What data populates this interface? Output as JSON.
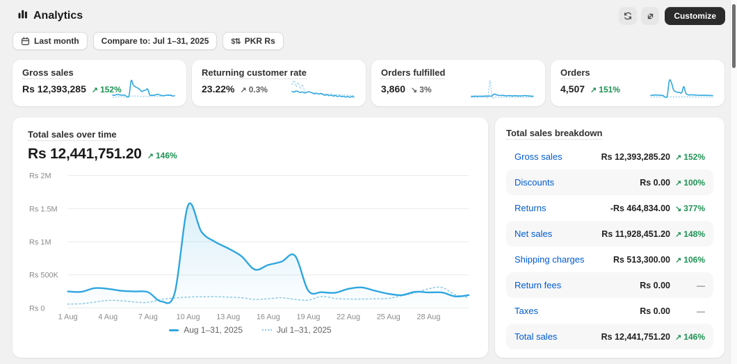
{
  "header": {
    "title": "Analytics",
    "customize_label": "Customize"
  },
  "filters": {
    "date_range": "Last month",
    "compare": "Compare to: Jul 1–31, 2025",
    "currency": "PKR Rs",
    "currency_glyph": "$⇅"
  },
  "colors": {
    "page_bg": "#f1f1f1",
    "accent_blue": "#2ea6df",
    "compare_blue": "#8fcae8",
    "link_blue": "#005bd3",
    "positive_green": "#1f9254",
    "neutral_gray": "#616161"
  },
  "cards": [
    {
      "title": "Gross sales",
      "value": "Rs 12,393,285",
      "arrow": "↗",
      "delta": "152%",
      "tone": "positive",
      "spark": {
        "main": [
          250,
          245,
          300,
          290,
          260,
          250,
          240,
          100,
          230,
          1550,
          1150,
          1000,
          900,
          780,
          580,
          650,
          700,
          790,
          260,
          240,
          230,
          290,
          310,
          260,
          215,
          195,
          245,
          235,
          235,
          175,
          195
        ],
        "compare": [
          60,
          65,
          90,
          115,
          110,
          90,
          85,
          130,
          150,
          165,
          170,
          170,
          165,
          155,
          130,
          140,
          155,
          130,
          120,
          175,
          145,
          135,
          135,
          140,
          145,
          185,
          230,
          290,
          310,
          200,
          160
        ]
      }
    },
    {
      "title": "Returning customer rate",
      "value": "23.22%",
      "arrow": "↗",
      "delta": "0.3%",
      "tone": "neutral",
      "spark": {
        "main": [
          23.5,
          23.2,
          23.8,
          23.4,
          23.0,
          23.3,
          22.8,
          23.0,
          23.4,
          23.1,
          22.7,
          22.3,
          22.6,
          22.2,
          22.5,
          22.0,
          21.6,
          21.9,
          21.4,
          21.7,
          21.2,
          21.5,
          21.0,
          21.3,
          20.9,
          21.1,
          20.7,
          21.0,
          20.6,
          20.9,
          20.7
        ],
        "compare": [
          27,
          29,
          26,
          28,
          25,
          27,
          24,
          23,
          23.5,
          23,
          22.8,
          23,
          22.5,
          22.3,
          22.6,
          22.4,
          22.2,
          22.4,
          22.1,
          22.3,
          22,
          21.8,
          22,
          21.9,
          21.7,
          21.8,
          21.6,
          21.7,
          21.5,
          21.6,
          21.4
        ]
      }
    },
    {
      "title": "Orders fulfilled",
      "value": "3,860",
      "arrow": "↘",
      "delta": "3%",
      "tone": "neutral",
      "spark": {
        "main": [
          118,
          116,
          120,
          117,
          121,
          118,
          120,
          123,
          119,
          122,
          125,
          160,
          148,
          138,
          132,
          136,
          130,
          127,
          131,
          128,
          125,
          130,
          127,
          124,
          126,
          129,
          132,
          127,
          124,
          121,
          119
        ],
        "compare": [
          100,
          99,
          101,
          100,
          102,
          100,
          101,
          103,
          102,
          420,
          101,
          100,
          102,
          101,
          100,
          102,
          101,
          103,
          100,
          102,
          101,
          100,
          102,
          101,
          103,
          102,
          100,
          101,
          102,
          100,
          101
        ]
      }
    },
    {
      "title": "Orders",
      "value": "4,507",
      "arrow": "↗",
      "delta": "151%",
      "tone": "positive",
      "spark": {
        "main": [
          140,
          138,
          146,
          144,
          140,
          138,
          134,
          100,
          130,
          430,
          390,
          250,
          210,
          200,
          195,
          190,
          310,
          180,
          150,
          146,
          148,
          145,
          142,
          140,
          138,
          140,
          139,
          138,
          137,
          136,
          135
        ],
        "compare": [
          105,
          103,
          106,
          104,
          105,
          103,
          104,
          106,
          105,
          107,
          106,
          105,
          107,
          106,
          104,
          106,
          105,
          107,
          105,
          106,
          104,
          105,
          106,
          104,
          106,
          105,
          107,
          106,
          105,
          104,
          105
        ]
      }
    }
  ],
  "chart_card": {
    "title": "Total sales over time",
    "value": "Rs 12,441,751.20",
    "arrow": "↗",
    "delta": "146%",
    "tone": "positive"
  },
  "chart_data": {
    "type": "line",
    "title": "Total sales over time",
    "unit": "PKR (thousands)",
    "ylim": [
      0,
      2000
    ],
    "grid": "horizontal",
    "y_ticks": [
      {
        "value": 2000,
        "label": "Rs 2M"
      },
      {
        "value": 1500,
        "label": "Rs 1.5M"
      },
      {
        "value": 1000,
        "label": "Rs 1M"
      },
      {
        "value": 500,
        "label": "Rs 500K"
      },
      {
        "value": 0,
        "label": "Rs 0"
      }
    ],
    "x_tick_days": [
      1,
      4,
      7,
      10,
      13,
      16,
      19,
      22,
      25,
      28
    ],
    "x_tick_labels": [
      "1 Aug",
      "4 Aug",
      "7 Aug",
      "10 Aug",
      "13 Aug",
      "16 Aug",
      "19 Aug",
      "22 Aug",
      "25 Aug",
      "28 Aug"
    ],
    "series": [
      {
        "name": "Aug 1–31, 2025",
        "style": "solid",
        "values": [
          250,
          245,
          300,
          290,
          260,
          250,
          240,
          100,
          230,
          1550,
          1150,
          1000,
          900,
          780,
          580,
          650,
          700,
          790,
          260,
          240,
          230,
          290,
          310,
          260,
          215,
          195,
          245,
          235,
          235,
          175,
          195
        ]
      },
      {
        "name": "Jul 1–31, 2025",
        "style": "dotted",
        "values": [
          60,
          65,
          90,
          115,
          110,
          90,
          85,
          130,
          150,
          165,
          170,
          170,
          165,
          155,
          130,
          140,
          155,
          130,
          120,
          175,
          145,
          135,
          135,
          140,
          145,
          185,
          230,
          290,
          310,
          200,
          160
        ]
      }
    ],
    "legend_position": "bottom-center"
  },
  "legend": [
    {
      "label": "Aug 1–31, 2025",
      "style": "solid"
    },
    {
      "label": "Jul 1–31, 2025",
      "style": "dotted"
    }
  ],
  "breakdown": {
    "title": "Total sales breakdown",
    "rows": [
      {
        "label": "Gross sales",
        "value": "Rs 12,393,285.20",
        "arrow": "↗",
        "delta": "152%",
        "tone": "positive"
      },
      {
        "label": "Discounts",
        "value": "Rs 0.00",
        "arrow": "↗",
        "delta": "100%",
        "tone": "positive"
      },
      {
        "label": "Returns",
        "value": "-Rs 464,834.00",
        "arrow": "↘",
        "delta": "377%",
        "tone": "positive"
      },
      {
        "label": "Net sales",
        "value": "Rs 11,928,451.20",
        "arrow": "↗",
        "delta": "148%",
        "tone": "positive"
      },
      {
        "label": "Shipping charges",
        "value": "Rs 513,300.00",
        "arrow": "↗",
        "delta": "106%",
        "tone": "positive"
      },
      {
        "label": "Return fees",
        "value": "Rs 0.00",
        "arrow": "",
        "delta": "—",
        "tone": "none"
      },
      {
        "label": "Taxes",
        "value": "Rs 0.00",
        "arrow": "",
        "delta": "—",
        "tone": "none"
      },
      {
        "label": "Total sales",
        "value": "Rs 12,441,751.20",
        "arrow": "↗",
        "delta": "146%",
        "tone": "positive"
      }
    ]
  }
}
